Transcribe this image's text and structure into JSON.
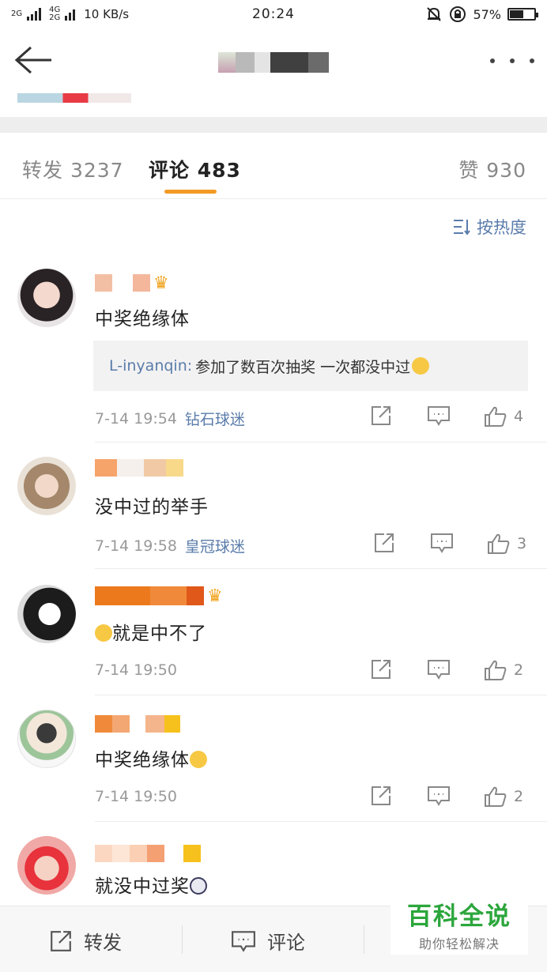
{
  "status_bar": {
    "network_small": "2G",
    "network_mid": "4G\n2G",
    "speed": "10 KB/s",
    "time": "20:24",
    "battery": "57%",
    "battery_level": 0.57
  },
  "tabs": {
    "repost": "转发 3237",
    "comment": "评论 483",
    "like": "赞 930"
  },
  "sort_label": "按热度",
  "comments": [
    {
      "text": "中奖绝缘体",
      "quote_user": "L-inyanqin:",
      "quote_text": "参加了数百次抽奖 一次都没中过",
      "time": "7-14 19:54",
      "badge": "钻石球迷",
      "likes": "4"
    },
    {
      "text": "没中过的举手",
      "time": "7-14 19:58",
      "badge": "皇冠球迷",
      "likes": "3"
    },
    {
      "text": "就是中不了",
      "time": "7-14 19:50",
      "likes": "2"
    },
    {
      "text": "中奖绝缘体",
      "time": "7-14 19:50",
      "likes": "2"
    },
    {
      "text": "就没中过奖"
    }
  ],
  "bottom_bar": {
    "repost": "转发",
    "comment": "评论"
  },
  "watermark": {
    "title": "百科全说",
    "subtitle": "助你轻松解决"
  },
  "colors": {
    "accent": "#f39a24",
    "link": "#5a7cab",
    "watermark_green": "#2ca63c"
  }
}
